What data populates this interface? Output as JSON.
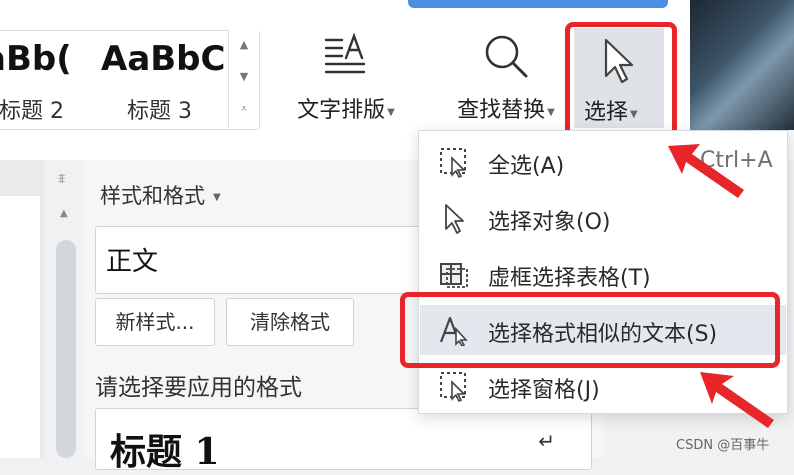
{
  "gallery": {
    "samples": [
      "aBb(",
      "AaBbC("
    ],
    "names": [
      "标题 2",
      "标题 3"
    ]
  },
  "toolbar": {
    "text_layout": "文字排版",
    "find_replace": "查找替换",
    "select": "选择"
  },
  "pane": {
    "title": "样式和格式",
    "current_style": "正文",
    "new_style_button": "新样式...",
    "clear_format_button": "清除格式",
    "hint": "请选择要应用的格式",
    "heading_preview": "标题 1",
    "return_mark": "↵"
  },
  "select_menu": {
    "items": [
      {
        "label": "全选(A)",
        "icon": "select-all-icon"
      },
      {
        "label": "选择对象(O)",
        "icon": "pointer-icon"
      },
      {
        "label": "虚框选择表格(T)",
        "icon": "table-marquee-icon"
      },
      {
        "label": "选择格式相似的文本(S)",
        "icon": "similar-format-icon"
      },
      {
        "label": "选择窗格(J)",
        "icon": "selection-pane-icon"
      }
    ],
    "select_all_shortcut": "Ctrl+A"
  },
  "watermark": "CSDN @百事牛",
  "colors": {
    "highlight_red": "#e8262a",
    "menu_hover": "#e4e8ee",
    "accent_blue": "#4a90e2"
  }
}
